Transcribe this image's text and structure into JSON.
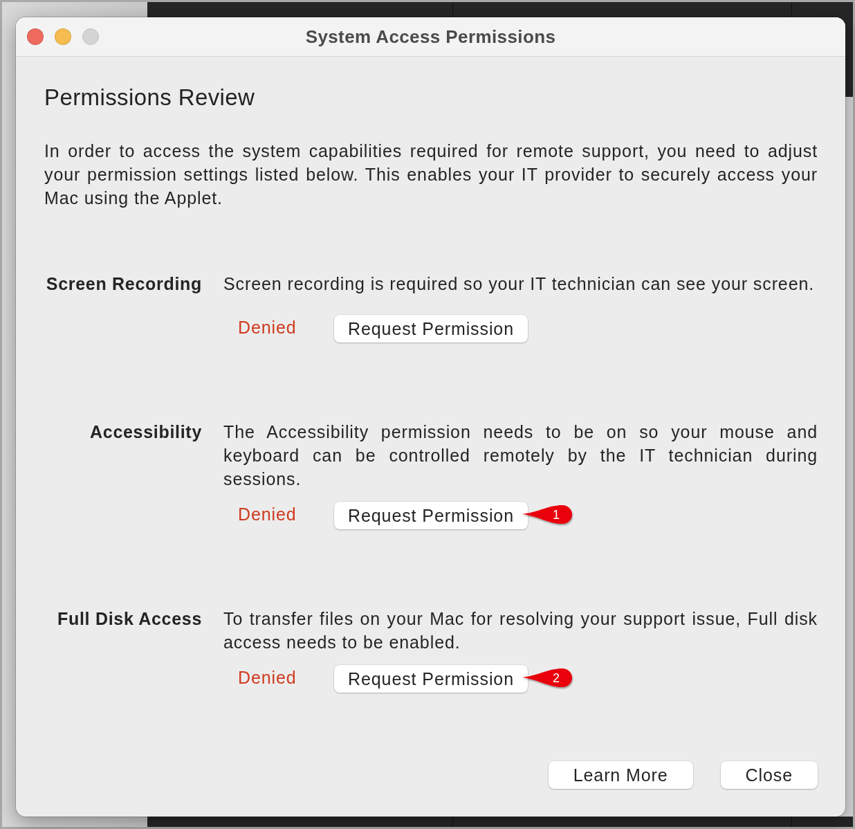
{
  "window": {
    "title": "System Access Permissions",
    "controls": [
      {
        "kind": "close",
        "disabled": false
      },
      {
        "kind": "minimize",
        "disabled": false
      },
      {
        "kind": "zoom",
        "disabled": true
      }
    ]
  },
  "heading": "Permissions Review",
  "intro": "In order to access the system capabilities required for remote support, you need to adjust your permission settings listed below. This enables your IT provider to securely access your Mac using the Applet.",
  "permissions": [
    {
      "name": "Screen Recording",
      "description": "Screen recording is required so your IT technician can see your screen.",
      "status": "Denied",
      "button": "Request Permission"
    },
    {
      "name": "Accessibility",
      "description": "The Accessibility permission needs to be on so your mouse and keyboard can be controlled remotely by the IT technician during sessions.",
      "status": "Denied",
      "button": "Request Permission",
      "annotation": "1"
    },
    {
      "name": "Full Disk Access",
      "description": "To transfer files on your Mac for resolving your support issue, Full disk access needs to be enabled.",
      "status": "Denied",
      "button": "Request Permission",
      "annotation": "2"
    }
  ],
  "footer_buttons": [
    "Learn More",
    "Close"
  ]
}
